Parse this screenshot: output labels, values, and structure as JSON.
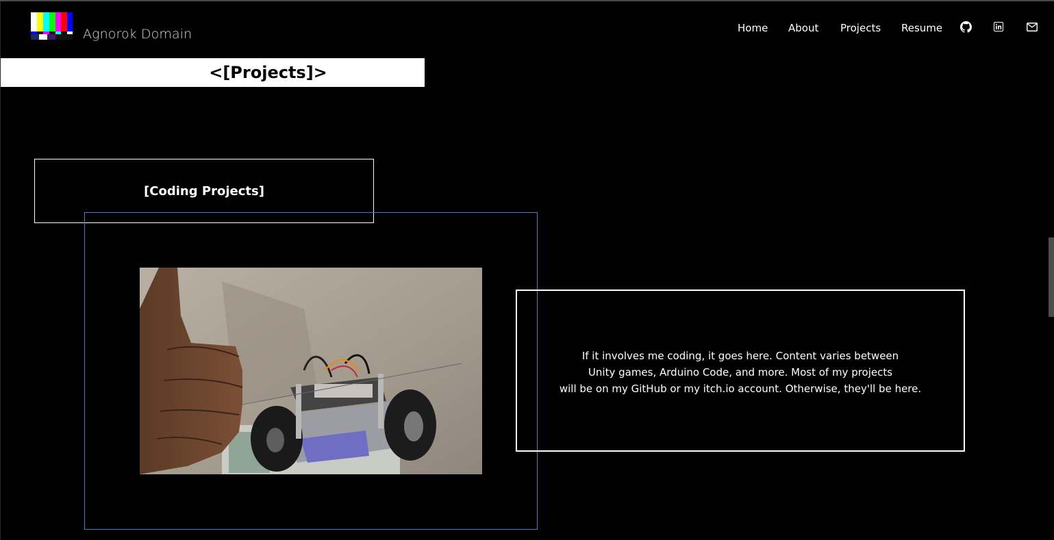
{
  "brand": {
    "name": "Agnorok Domain",
    "logo_icon": "test-pattern-logo-icon"
  },
  "nav": {
    "items": [
      {
        "label": "Home"
      },
      {
        "label": "About"
      },
      {
        "label": "Projects"
      },
      {
        "label": "Resume"
      }
    ],
    "icons": [
      "github-icon",
      "linkedin-icon",
      "mail-icon"
    ]
  },
  "page": {
    "title": "<[Projects]>"
  },
  "section": {
    "heading": "[Coding Projects]",
    "description_lines": [
      "If it involves me coding, it goes here. Content varies between",
      "Unity games, Arduino Code, and more. Most of my projects",
      "will be on my GitHub or my itch.io account. Otherwise, they'll be here."
    ],
    "image": "arduino-robot-thumbs-up-photo"
  },
  "colors": {
    "background": "#000000",
    "accent_frame": "#3d7fd6",
    "text": "#ffffff",
    "title_bar": "#ffffff"
  }
}
